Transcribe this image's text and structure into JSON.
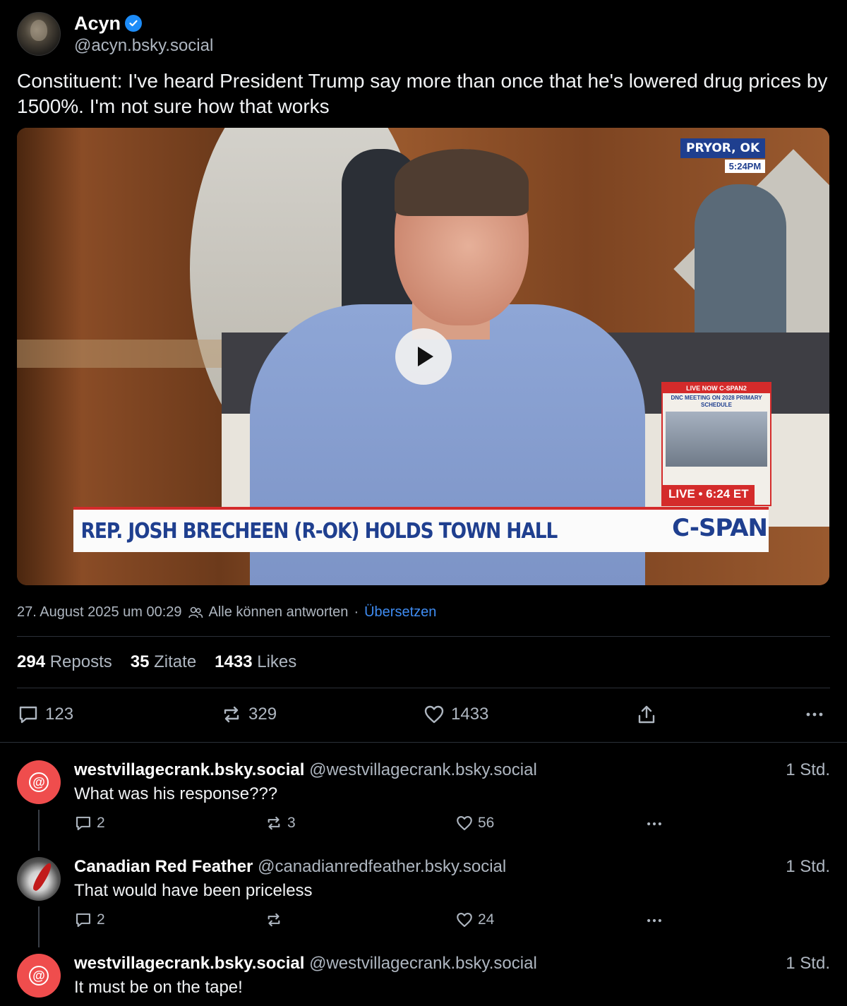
{
  "post": {
    "author_name": "Acyn",
    "author_handle": "@acyn.bsky.social",
    "text": "Constituent: I've heard President Trump say more than once that he's lowered drug prices by 1500%. I'm not sure how that works",
    "video": {
      "location": "PRYOR, OK",
      "location_time": "5:24PM",
      "inset_title": "LIVE NOW C-SPAN2",
      "inset_subtitle": "DNC MEETING ON 2028 PRIMARY SCHEDULE",
      "live_label": "LIVE • 6:24 ET",
      "lower_third": "REP. JOSH BRECHEEN (R-OK) HOLDS TOWN HALL",
      "network": "C-SPAN"
    },
    "timestamp": "27. August 2025 um 00:29",
    "reply_setting": "Alle können antworten",
    "separator": "·",
    "translate": "Übersetzen",
    "stats": {
      "reposts_count": "294",
      "reposts_label": "Reposts",
      "quotes_count": "35",
      "quotes_label": "Zitate",
      "likes_count": "1433",
      "likes_label": "Likes"
    },
    "actions": {
      "replies": "123",
      "reposts": "329",
      "likes": "1433"
    }
  },
  "replies": [
    {
      "name": "westvillagecrank.bsky.social",
      "handle": "@westvillagecrank.bsky.social",
      "time": "1 Std.",
      "text": "What was his response???",
      "replies": "2",
      "reposts": "3",
      "likes": "56"
    },
    {
      "name": "Canadian Red Feather",
      "handle": "@canadianredfeather.bsky.social",
      "time": "1 Std.",
      "text": "That would have been priceless",
      "replies": "2",
      "reposts": "",
      "likes": "24"
    },
    {
      "name": "westvillagecrank.bsky.social",
      "handle": "@westvillagecrank.bsky.social",
      "time": "1 Std.",
      "text": "It must be on the tape!"
    }
  ],
  "colors": {
    "background": "#000000",
    "accent_link": "#3f8cf2",
    "verified": "#1d8cf8",
    "default_avatar": "#ef4d4d",
    "muted_text": "#aeb6c0"
  }
}
